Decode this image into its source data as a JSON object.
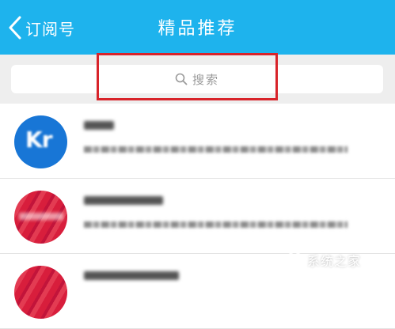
{
  "app": {
    "header": {
      "back_label": "订阅号",
      "title": "精品推荐"
    },
    "search": {
      "placeholder": "搜索",
      "icon": "search-icon"
    },
    "list_items": [
      {
        "avatar_initials": "Kr",
        "avatar_color": "#1876d6"
      },
      {
        "avatar_color": "#d81e3c"
      },
      {
        "avatar_color": "#d81e3c"
      }
    ],
    "watermark": {
      "text": "系统之家"
    },
    "colors": {
      "header_bg": "#1eb3ed",
      "highlight": "#d8232a",
      "search_zone_bg": "#eeeeee"
    }
  }
}
